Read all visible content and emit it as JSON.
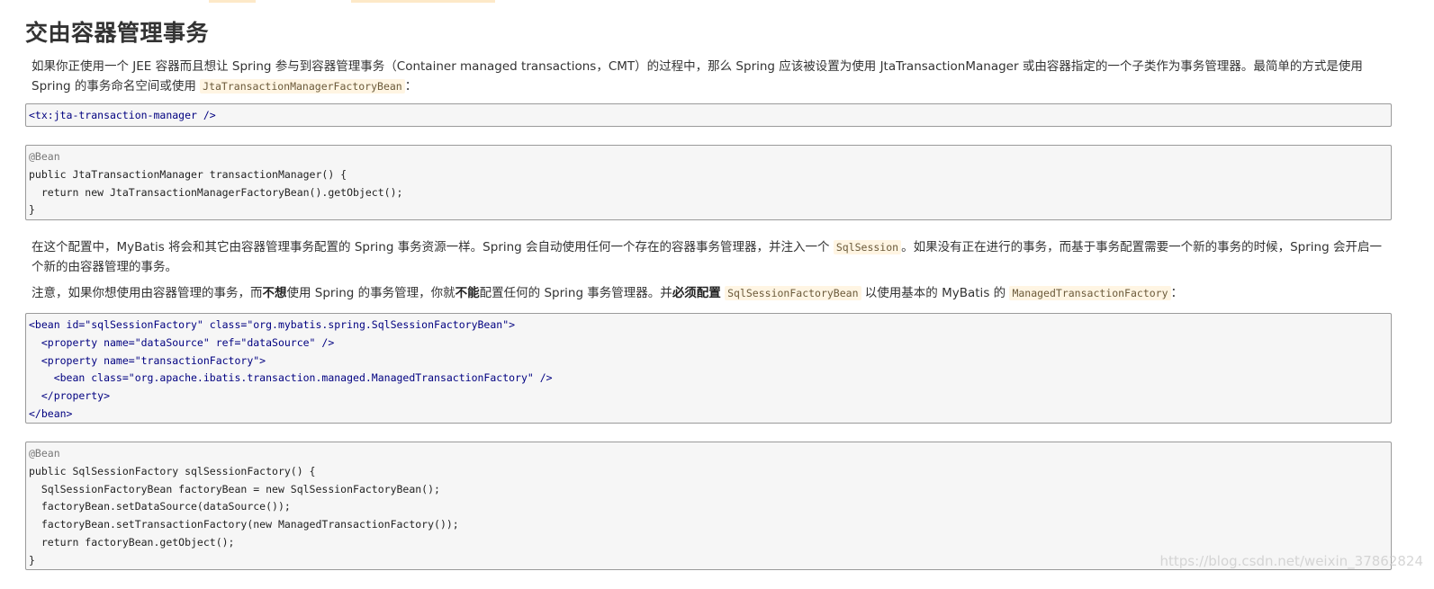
{
  "title": "交由容器管理事务",
  "paragraph1": {
    "text": "如果你正使用一个 JEE 容器而且想让 Spring 参与到容器管理事务（Container managed transactions，CMT）的过程中，那么 Spring 应该被设置为使用 JtaTransactionManager 或由容器指定的一个子类作为事务管理器。最简单的方式是使用 Spring 的事务命名空间或使用 ",
    "code": "JtaTransactionManagerFactoryBean",
    "tail": "："
  },
  "code_block_1": [
    "<tx:jta-transaction-manager />"
  ],
  "code_block_2": [
    "@Bean",
    "public JtaTransactionManager transactionManager() {",
    "  return new JtaTransactionManagerFactoryBean().getObject();",
    "}"
  ],
  "paragraph2": {
    "text": "在这个配置中，MyBatis 将会和其它由容器管理事务配置的 Spring 事务资源一样。Spring 会自动使用任何一个存在的容器事务管理器，并注入一个 ",
    "code": "SqlSession",
    "tail": "。如果没有正在进行的事务，而基于事务配置需要一个新的事务的时候，Spring 会开启一个新的由容器管理的事务。"
  },
  "paragraph3": {
    "text1": "注意，如果你想使用由容器管理的事务，而",
    "bold1": "不想",
    "text2": "使用 Spring 的事务管理，你就",
    "bold2": "不能",
    "text3": "配置任何的 Spring 事务管理器。并",
    "bold3": "必须配置",
    "text4": " ",
    "code1": "SqlSessionFactoryBean",
    "text5": " 以使用基本的 MyBatis 的 ",
    "code2": "ManagedTransactionFactory",
    "tail": "："
  },
  "code_block_3": [
    "<bean id=\"sqlSessionFactory\" class=\"org.mybatis.spring.SqlSessionFactoryBean\">",
    "  <property name=\"dataSource\" ref=\"dataSource\" />",
    "  <property name=\"transactionFactory\">",
    "    <bean class=\"org.apache.ibatis.transaction.managed.ManagedTransactionFactory\" />",
    "  </property>",
    "</bean>"
  ],
  "code_block_4": [
    "@Bean",
    "public SqlSessionFactory sqlSessionFactory() {",
    "  SqlSessionFactoryBean factoryBean = new SqlSessionFactoryBean();",
    "  factoryBean.setDataSource(dataSource());",
    "  factoryBean.setTransactionFactory(new ManagedTransactionFactory());",
    "  return factoryBean.getObject();",
    "}"
  ],
  "watermark": "https://blog.csdn.net/weixin_37862824"
}
